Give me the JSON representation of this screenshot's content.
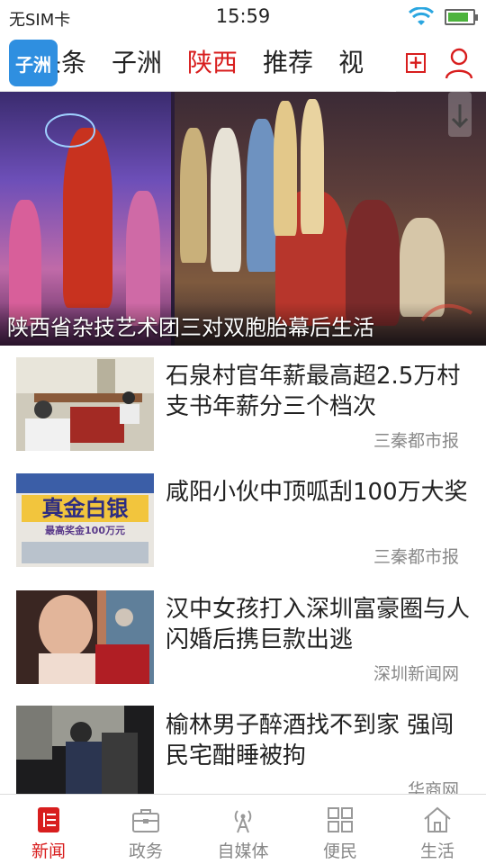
{
  "status_bar": {
    "carrier": "无SIM卡",
    "time": "15:59",
    "battery_level": 0.85
  },
  "channels": {
    "logo_text": "子洲",
    "tabs": [
      "头条",
      "子洲",
      "陕西",
      "推荐",
      "视"
    ],
    "active_tab": "陕西",
    "add_icon": "plus-icon",
    "user_icon": "user-icon"
  },
  "banner": {
    "title": "陕西省杂技艺术团三对双胞胎幕后生活"
  },
  "news": [
    {
      "headline": "石泉村官年薪最高超2.5万村支书年薪分三个档次",
      "source": "三秦都市报"
    },
    {
      "headline": "咸阳小伙中顶呱刮100万大奖",
      "source": "三秦都市报"
    },
    {
      "headline": "汉中女孩打入深圳富豪圈与人闪婚后携巨款出逃",
      "source": "深圳新闻网"
    },
    {
      "headline": "榆林男子醉酒找不到家 强闯民宅酣睡被拘",
      "source": "华商网"
    }
  ],
  "thumb_text": {
    "lottery_big": "真金白银",
    "lottery_prize": "最高奖金100万元"
  },
  "tabbar": [
    {
      "label": "新闻",
      "icon": "news-icon",
      "active": true
    },
    {
      "label": "政务",
      "icon": "briefcase-icon",
      "active": false
    },
    {
      "label": "自媒体",
      "icon": "broadcast-icon",
      "active": false
    },
    {
      "label": "便民",
      "icon": "grid-icon",
      "active": false
    },
    {
      "label": "生活",
      "icon": "home-icon",
      "active": false
    }
  ],
  "colors": {
    "accent": "#d81e1e",
    "logo_bg": "#2f8fe0",
    "text": "#222222",
    "muted": "#888888"
  }
}
